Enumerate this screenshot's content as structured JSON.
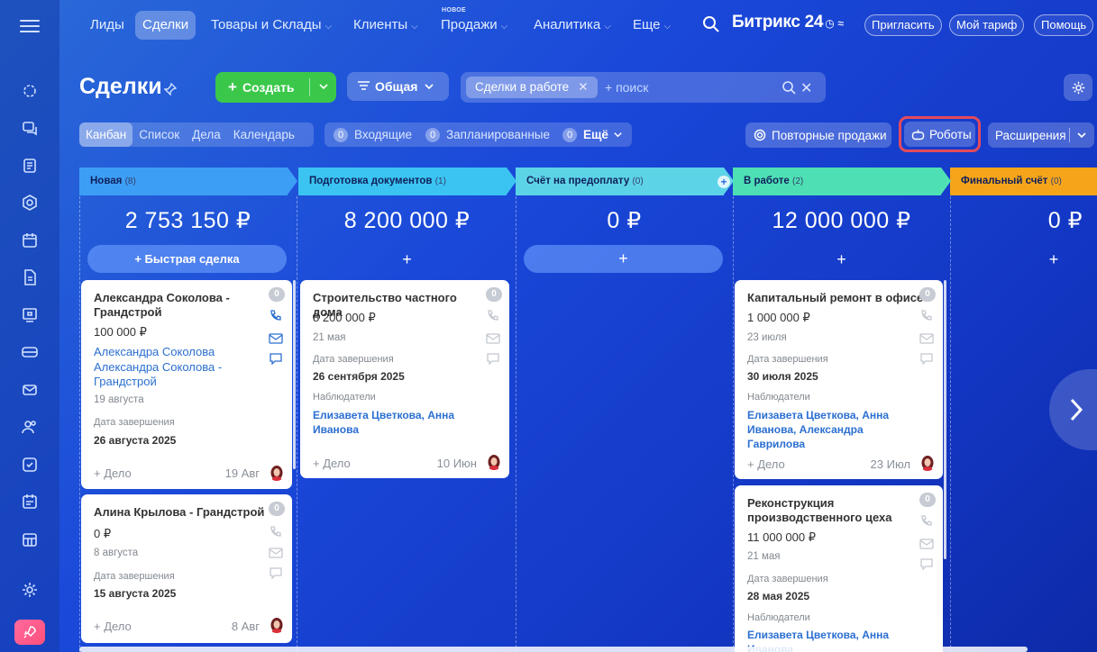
{
  "nav": {
    "items": [
      {
        "label": "Лиды",
        "chevron": false,
        "active": false
      },
      {
        "label": "Сделки",
        "chevron": false,
        "active": true
      },
      {
        "label": "Товары и Склады",
        "chevron": true,
        "active": false
      },
      {
        "label": "Клиенты",
        "chevron": true,
        "active": false
      },
      {
        "label": "Продажи",
        "chevron": true,
        "active": false
      },
      {
        "label": "Аналитика",
        "chevron": true,
        "active": false
      },
      {
        "label": "Еще",
        "chevron": true,
        "active": false
      }
    ],
    "new_badge": "НОВОЕ",
    "brand": "Битрикс",
    "brand_num": "24",
    "invite": "Пригласить",
    "tariff": "Мой тариф",
    "help": "Помощь"
  },
  "toolbar": {
    "title": "Сделки",
    "create": "Создать",
    "general": "Общая",
    "filter_chip": "Сделки в работе",
    "search_placeholder": "+ поиск"
  },
  "views": [
    "Канбан",
    "Список",
    "Дела",
    "Календарь"
  ],
  "counters": [
    {
      "count": "0",
      "label": "Входящие"
    },
    {
      "count": "0",
      "label": "Запланированные"
    },
    {
      "count": "0",
      "label": "Ещё"
    }
  ],
  "actions": {
    "repeat": "Повторные продажи",
    "robots": "Роботы",
    "extensions": "Расширения"
  },
  "columns": [
    {
      "name": "Новая",
      "count": "(8)",
      "sum": "2 753 150 ₽",
      "color": "#3d9ef5",
      "quick": "+ Быстрая сделка"
    },
    {
      "name": "Подготовка документов",
      "count": "(1)",
      "sum": "8 200 000 ₽",
      "color": "#3bc4f2",
      "quick": "+"
    },
    {
      "name": "Счёт на предоплату",
      "count": "(0)",
      "sum": "0 ₽",
      "color": "#5dd3e8",
      "quick": "+"
    },
    {
      "name": "В работе",
      "count": "(2)",
      "sum": "12 000 000 ₽",
      "color": "#4ee0b4",
      "quick": "+"
    },
    {
      "name": "Финальный счёт",
      "count": "(0)",
      "sum": "0 ₽",
      "color": "#f6a51a",
      "quick": "+"
    }
  ],
  "cards": {
    "c1": {
      "title": "Александра Соколова - Грандстрой",
      "count": "0",
      "amount": "100 000 ₽",
      "link1": "Александра Соколова",
      "link2": "Александра Соколова - Грандстрой",
      "date": "19 августа",
      "end_label": "Дата завершения",
      "end_date": "26 августа 2025",
      "add": "+ Дело",
      "foot_date": "19 Авг"
    },
    "c2": {
      "title": "Алина Крылова - Грандстрой",
      "count": "0",
      "amount": "0 ₽",
      "date": "8 августа",
      "end_label": "Дата завершения",
      "end_date": "15 августа 2025",
      "add": "+ Дело",
      "foot_date": "8 Авг"
    },
    "c3": {
      "title": "Строительство частного дома",
      "count": "0",
      "amount": "8 200 000 ₽",
      "date": "21 мая",
      "end_label": "Дата завершения",
      "end_date": "26 сентября 2025",
      "obs_label": "Наблюдатели",
      "observers": "Елизавета Цветкова, Анна Иванова",
      "add": "+ Дело",
      "foot_date": "10 Июн"
    },
    "c4": {
      "title": "Капитальный ремонт в офисе",
      "count": "0",
      "amount": "1 000 000 ₽",
      "date": "23 июля",
      "end_label": "Дата завершения",
      "end_date": "30 июля 2025",
      "obs_label": "Наблюдатели",
      "observers": "Елизавета Цветкова, Анна Иванова, Александра Гаврилова",
      "add": "+ Дело",
      "foot_date": "23 Июл"
    },
    "c5": {
      "title": "Реконструкция производственного цеха",
      "count": "0",
      "amount": "11 000 000 ₽",
      "date": "21 мая",
      "end_label": "Дата завершения",
      "end_date": "28 мая 2025",
      "obs_label": "Наблюдатели",
      "observers": "Елизавета Цветкова, Анна Иванова"
    }
  }
}
